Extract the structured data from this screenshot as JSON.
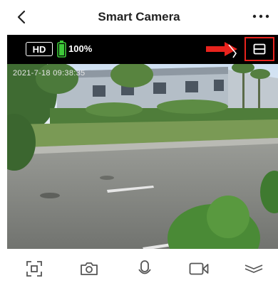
{
  "header": {
    "title": "Smart Camera"
  },
  "stream": {
    "quality": "HD",
    "battery_percent": "100%",
    "timestamp": "2021-7-18 09:38:35"
  },
  "icons": {
    "back": "chevron-left-icon",
    "more": "more-dots-icon",
    "battery": "battery-full-icon",
    "layout": "split-view-icon",
    "screenshot": "screenshot-frame-icon",
    "camera": "camera-icon",
    "microphone": "microphone-icon",
    "record": "video-record-icon",
    "collapse": "chevron-down-icon"
  },
  "colors": {
    "accent_red": "#e8231d",
    "battery_green": "#3ec83a"
  }
}
